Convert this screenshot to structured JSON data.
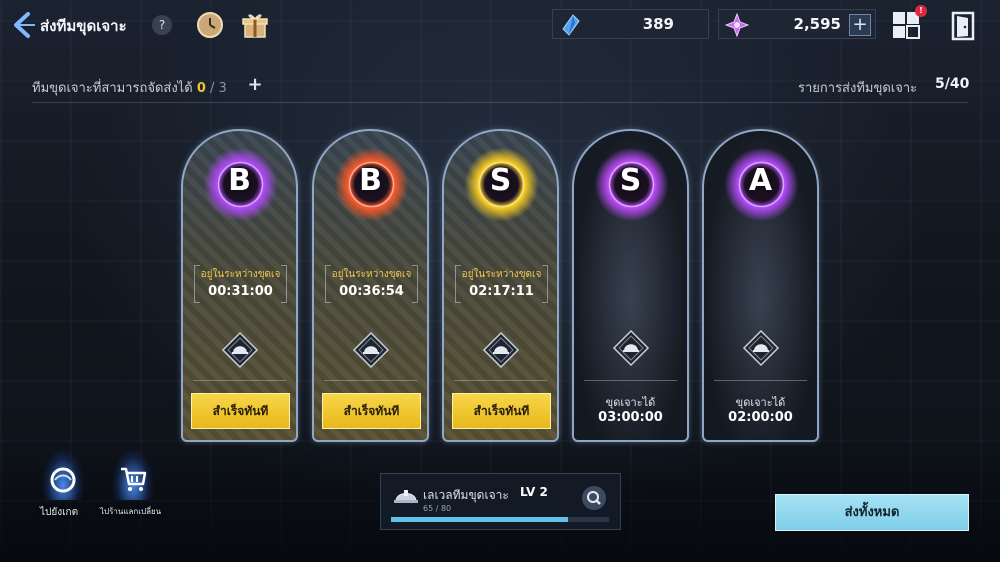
{
  "header": {
    "title": "ส่งทีมขุดเจาะ",
    "help_label": "?",
    "icons": [
      "back-arrow-icon",
      "clock-icon",
      "gift-box-icon",
      "menu-grid-icon",
      "exit-door-icon"
    ]
  },
  "currencies": [
    {
      "name": "crystal",
      "value": "389",
      "icon": "blue-crystal-icon"
    },
    {
      "name": "gem",
      "value": "2,595",
      "icon": "purple-gem-icon",
      "plus": "+"
    }
  ],
  "menu_badge": "!",
  "dispatch": {
    "label": "ทีมขุดเจาะที่สามารถจัดส่งได้",
    "current": "0",
    "separator": "/",
    "max": "3",
    "plus": "+"
  },
  "list_info": {
    "label": "รายการส่งทีมขุดเจาะ",
    "value": "5/40"
  },
  "cards": [
    {
      "rank": "B",
      "orb_color": "#b24bff",
      "state": "active",
      "status_label": "อยู่ในระหว่างขุดเจ",
      "time": "00:31:00",
      "button": "สำเร็จทันที"
    },
    {
      "rank": "B",
      "orb_color": "#ff5a2a",
      "state": "active",
      "status_label": "อยู่ในระหว่างขุดเจ",
      "time": "00:36:54",
      "button": "สำเร็จทันที"
    },
    {
      "rank": "S",
      "orb_color": "#ffd21f",
      "state": "active",
      "status_label": "อยู่ในระหว่างขุดเจ",
      "time": "02:17:11",
      "button": "สำเร็จทันที"
    },
    {
      "rank": "S",
      "orb_color": "#c14bff",
      "state": "idle",
      "drill_label": "ขุดเจาะได้",
      "drill_time": "03:00:00"
    },
    {
      "rank": "A",
      "orb_color": "#b64bff",
      "state": "idle",
      "drill_label": "ขุดเจาะได้",
      "drill_time": "02:00:00"
    }
  ],
  "bottom_nav": [
    {
      "label": "ไปยังเกต",
      "icon": "portal-icon"
    },
    {
      "label": "ไปร้านแลกเปลี่ยน",
      "icon": "shopping-cart-icon"
    }
  ],
  "level_panel": {
    "label": "เลเวลทีมขุดเจาะ",
    "level": "LV 2",
    "exp": "65 / 80",
    "progress": 0.8125
  },
  "send_all_label": "ส่งทั้งหมด",
  "colors": {
    "accent_yellow": "#f1c232",
    "button_yellow": "#f0c52e",
    "button_cyan": "#8fd6ee",
    "card_border": "#8fa7c4"
  }
}
